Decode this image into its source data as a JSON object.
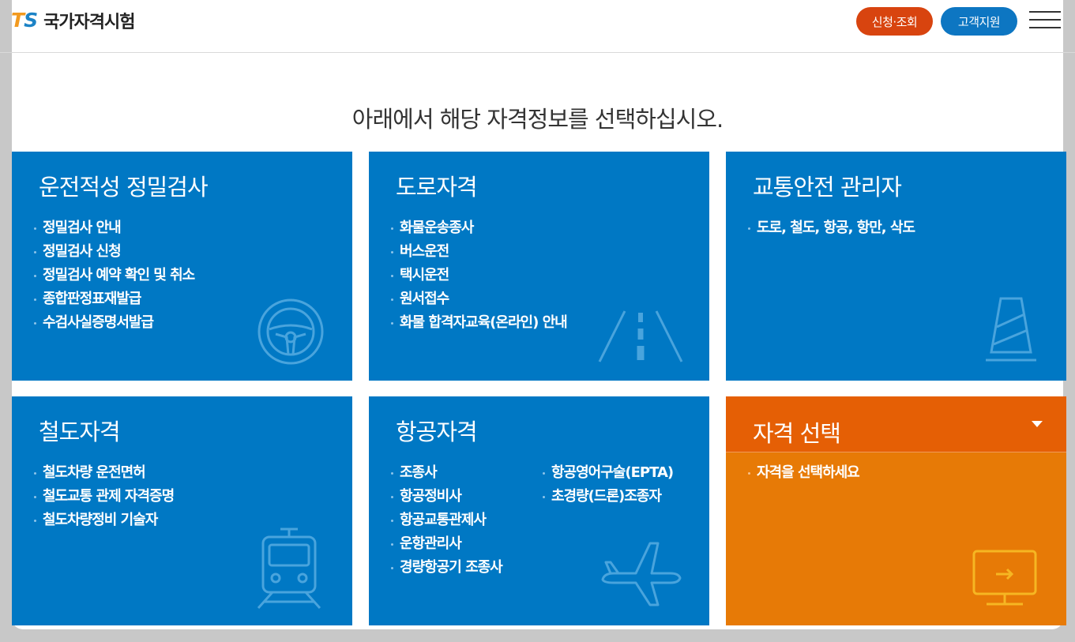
{
  "header": {
    "logo_mark_t": "T",
    "logo_mark_s": "S",
    "logo_text": "국가자격시험",
    "apply_button": "신청·조회",
    "support_button": "고객지원",
    "menu_icon": "hamburger-menu-icon"
  },
  "main": {
    "headline": "아래에서 해당 자격정보를 선택하십시오."
  },
  "cards": [
    {
      "title": "운전적성 정밀검사",
      "icon": "steering-wheel-icon",
      "items": [
        "정밀검사 안내",
        "정밀검사 신청",
        "정밀검사 예약 확인 및 취소",
        "종합판정표재발급",
        "수검사실증명서발급"
      ]
    },
    {
      "title": "도로자격",
      "icon": "road-icon",
      "items": [
        "화물운송종사",
        "버스운전",
        "택시운전",
        "원서접수",
        "화물 합격자교육(온라인) 안내"
      ]
    },
    {
      "title": "교통안전 관리자",
      "icon": "traffic-cone-icon",
      "items": [
        "도로, 철도, 항공, 항만, 삭도"
      ]
    },
    {
      "title": "철도자격",
      "icon": "train-icon",
      "items": [
        "철도차량 운전면허",
        "철도교통 관제 자격증명",
        "철도차량정비 기술자"
      ]
    },
    {
      "title": "항공자격",
      "icon": "airplane-icon",
      "items": [
        "조종사",
        "항공정비사",
        "항공교통관제사",
        "운항관리사",
        "경량항공기 조종사"
      ],
      "items_col2": [
        "항공영어구술(EPTA)",
        "초경량(드론)조종자"
      ]
    },
    {
      "title": "자격 선택",
      "icon": "monitor-arrow-icon",
      "dropdown_icon": "caret-down-icon",
      "items": [
        "자격을 선택하세요"
      ]
    }
  ],
  "colors": {
    "card_blue": "#0078c4",
    "select_orange": "#e77a06",
    "apply_red": "#d8440f",
    "support_blue": "#0d76c2"
  }
}
